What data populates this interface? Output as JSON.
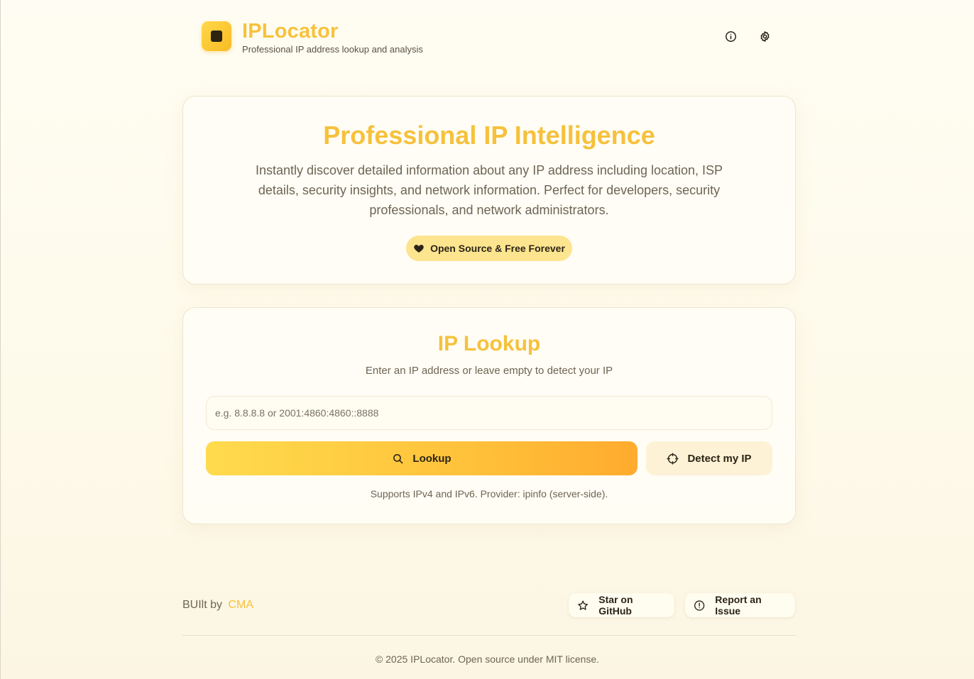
{
  "header": {
    "app_title": "IPLocator",
    "subtitle": "Professional IP address lookup and analysis",
    "icons": [
      "info-icon",
      "settings-gear-icon"
    ]
  },
  "hero": {
    "title": "Professional IP Intelligence",
    "description": "Instantly discover detailed information about any IP address including location, ISP details, security insights, and network information. Perfect for developers, security professionals, and network administrators.",
    "badge_label": "Open Source & Free Forever",
    "badge_icon": "heart-icon"
  },
  "lookup": {
    "title": "IP Lookup",
    "subtitle": "Enter an IP address or leave empty to detect your IP",
    "input_value": "",
    "input_placeholder": "e.g. 8.8.8.8 or 2001:4860:4860::8888",
    "lookup_label": "Lookup",
    "detect_label": "Detect my IP",
    "note": "Supports IPv4 and IPv6. Provider: ipinfo (server-side)."
  },
  "footer": {
    "built_by_prefix": "BUIlt by",
    "built_by_author": "CMA",
    "star_label": "Star on GitHub",
    "issue_label": "Report an Issue",
    "copyright": "© 2025 IPLocator. Open source under MIT license."
  },
  "colors": {
    "accent": "#f6c13c",
    "button_gradient_start": "#ffdb4d",
    "button_gradient_end": "#ffab2e",
    "badge_bg": "#fde48f",
    "text_dark": "#2b2416",
    "text_muted": "#6e6454"
  }
}
